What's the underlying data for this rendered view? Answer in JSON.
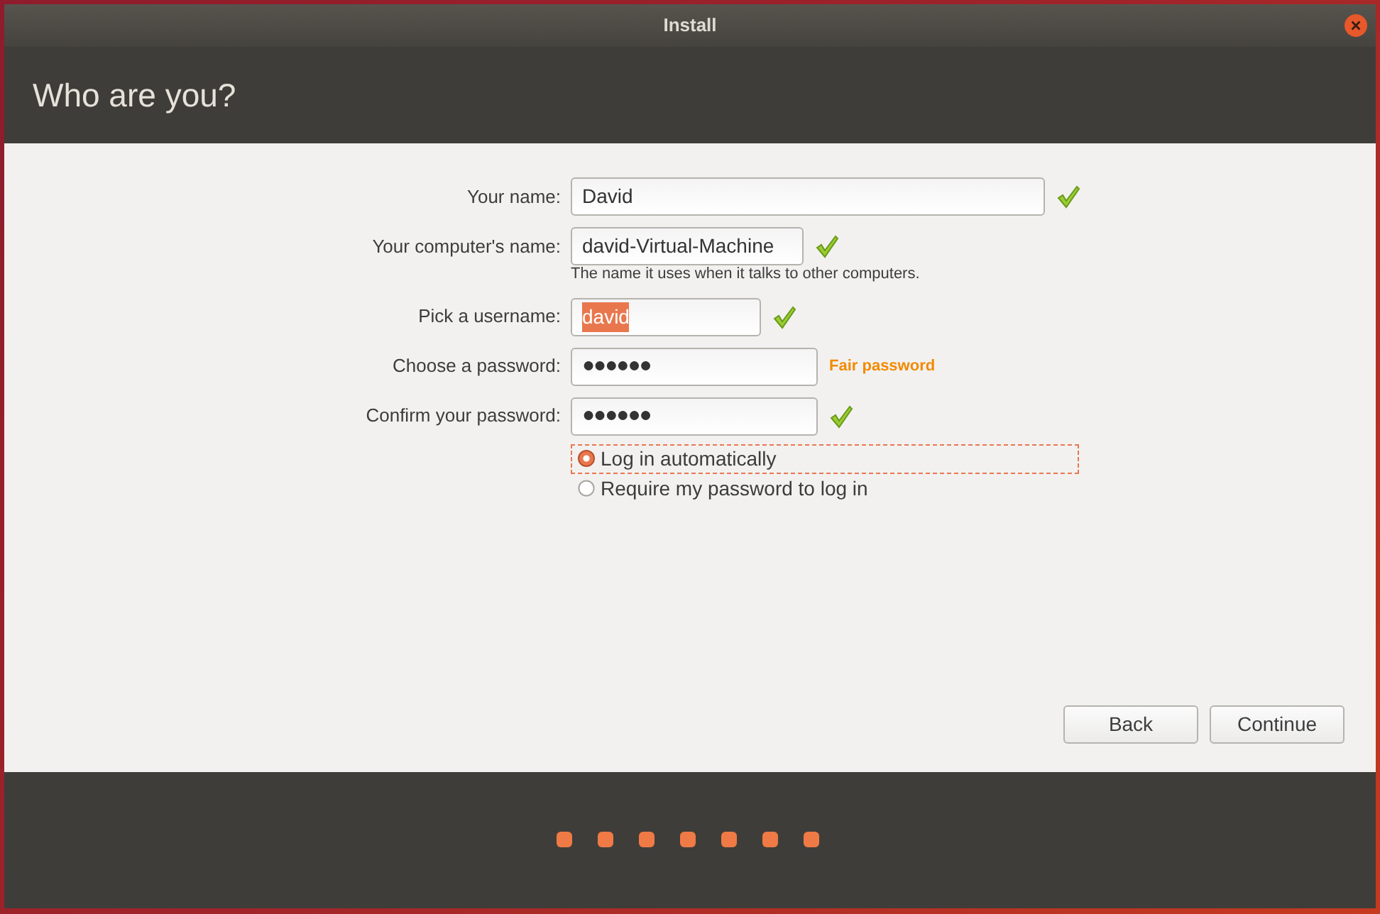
{
  "window": {
    "title": "Install"
  },
  "heading": "Who are you?",
  "fields": [
    {
      "label": "Your name:",
      "value": "David",
      "text_selected": false,
      "status": {
        "kind": "check"
      }
    },
    {
      "label": "Your computer's name:",
      "value": "david-Virtual-Machine",
      "text_selected": false,
      "status": {
        "kind": "check"
      },
      "hint": "The name it uses when it talks to other computers."
    },
    {
      "label": "Pick a username:",
      "value": "david",
      "text_selected": true,
      "status": {
        "kind": "check"
      }
    },
    {
      "label": "Choose a password:",
      "value": "●●●●●●",
      "text_selected": false,
      "status": {
        "kind": "text",
        "text": "Fair password"
      }
    },
    {
      "label": "Confirm your password:",
      "value": "●●●●●●",
      "text_selected": false,
      "status": {
        "kind": "check"
      }
    }
  ],
  "login_options": [
    {
      "label": "Log in automatically",
      "selected": true,
      "focused": true
    },
    {
      "label": "Require my password to log in",
      "selected": false,
      "focused": false
    }
  ],
  "buttons": [
    "Back",
    "Continue"
  ]
}
